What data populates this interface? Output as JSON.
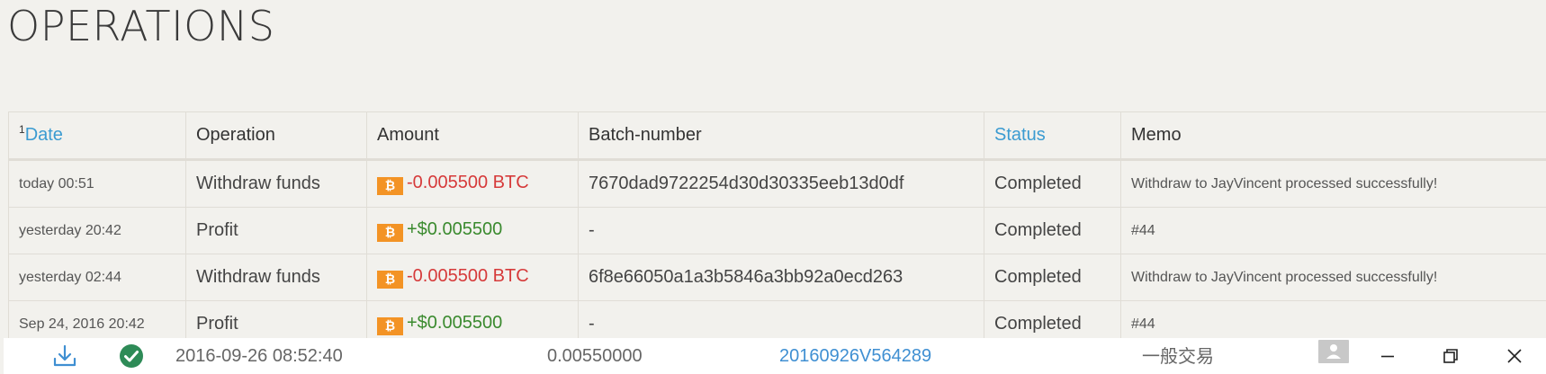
{
  "page": {
    "title": "OPERATIONS"
  },
  "table": {
    "headers": {
      "date_sup": "1",
      "date": "Date",
      "operation": "Operation",
      "amount": "Amount",
      "batch": "Batch-number",
      "status": "Status",
      "memo": "Memo"
    },
    "rows": [
      {
        "date": "today 00:51",
        "operation": "Withdraw funds",
        "amount": "-0.005500 BTC",
        "amount_sign": "negative",
        "batch": "7670dad9722254d30d30335eeb13d0df",
        "status": "Completed",
        "memo": "Withdraw to JayVincent processed successfully!"
      },
      {
        "date": "yesterday 20:42",
        "operation": "Profit",
        "amount": "+$0.005500",
        "amount_sign": "positive",
        "batch": "-",
        "status": "Completed",
        "memo": "#44"
      },
      {
        "date": "yesterday 02:44",
        "operation": "Withdraw funds",
        "amount": "-0.005500 BTC",
        "amount_sign": "negative",
        "batch": "6f8e66050a1a3b5846a3bb92a0ecd263",
        "status": "Completed",
        "memo": "Withdraw to JayVincent processed successfully!"
      },
      {
        "date": "Sep 24, 2016 20:42",
        "operation": "Profit",
        "amount": "+$0.005500",
        "amount_sign": "positive",
        "batch": "-",
        "status": "Completed",
        "memo": "#44"
      }
    ],
    "currency_icon": "bitcoin-icon",
    "currency_glyph": "₿"
  },
  "bottom_bar": {
    "datetime": "2016-09-26 08:52:40",
    "amount": "0.00550000",
    "batch": "20160926V564289",
    "type": "一般交易"
  },
  "colors": {
    "background": "#f2f1ed",
    "link": "#3b9bd1",
    "negative": "#d63a3a",
    "positive": "#3a8a2e",
    "btc_badge": "#f39325",
    "check": "#2e8b57"
  }
}
